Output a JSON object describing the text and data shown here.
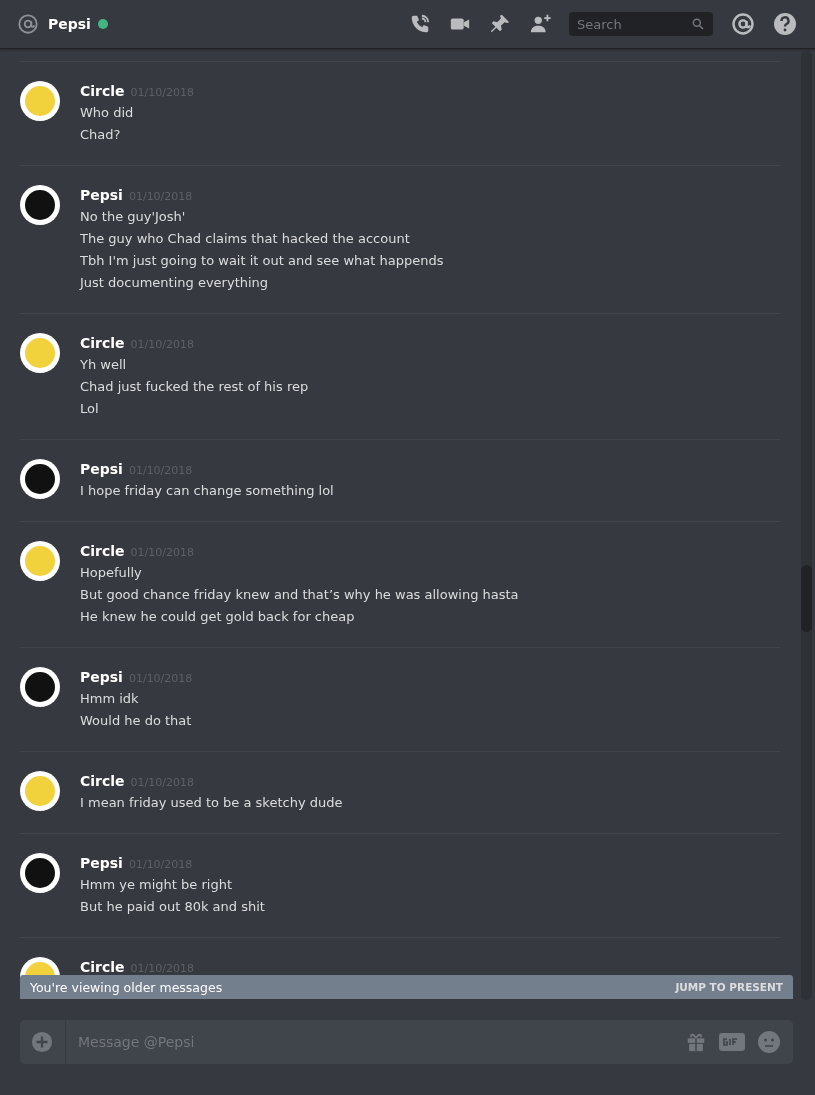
{
  "header": {
    "name": "Pepsi",
    "online": true,
    "search": {
      "placeholder": "Search"
    }
  },
  "messages": [
    {
      "author": "Circle",
      "timestamp": "01/10/2018",
      "color": "#f2d23c",
      "lines": [
        "Who did",
        "Chad?"
      ]
    },
    {
      "author": "Pepsi",
      "timestamp": "01/10/2018",
      "color": "#111111",
      "lines": [
        "No the guy'Josh'",
        "The guy who Chad claims that hacked the account",
        "Tbh I'm just going to wait it out and see what happends",
        "Just documenting everything"
      ]
    },
    {
      "author": "Circle",
      "timestamp": "01/10/2018",
      "color": "#f2d23c",
      "lines": [
        "Yh well",
        "Chad just fucked the rest of his rep",
        "Lol"
      ]
    },
    {
      "author": "Pepsi",
      "timestamp": "01/10/2018",
      "color": "#111111",
      "lines": [
        "I hope friday can change something lol"
      ]
    },
    {
      "author": "Circle",
      "timestamp": "01/10/2018",
      "color": "#f2d23c",
      "lines": [
        "Hopefully",
        "But good chance friday knew and that’s why he was allowing hasta",
        "He knew he could get gold back for cheap"
      ]
    },
    {
      "author": "Pepsi",
      "timestamp": "01/10/2018",
      "color": "#111111",
      "lines": [
        "Hmm idk",
        "Would he do that"
      ]
    },
    {
      "author": "Circle",
      "timestamp": "01/10/2018",
      "color": "#f2d23c",
      "lines": [
        "I mean friday used to be a sketchy dude"
      ]
    },
    {
      "author": "Pepsi",
      "timestamp": "01/10/2018",
      "color": "#111111",
      "lines": [
        "Hmm ye might be right",
        "But he paid out 80k and shit"
      ]
    },
    {
      "author": "Circle",
      "timestamp": "01/10/2018",
      "color": "#f2d23c"
    }
  ],
  "banner": {
    "text": "You're viewing older messages",
    "action": "JUMP TO PRESENT"
  },
  "composer": {
    "placeholder": "Message @Pepsi"
  }
}
